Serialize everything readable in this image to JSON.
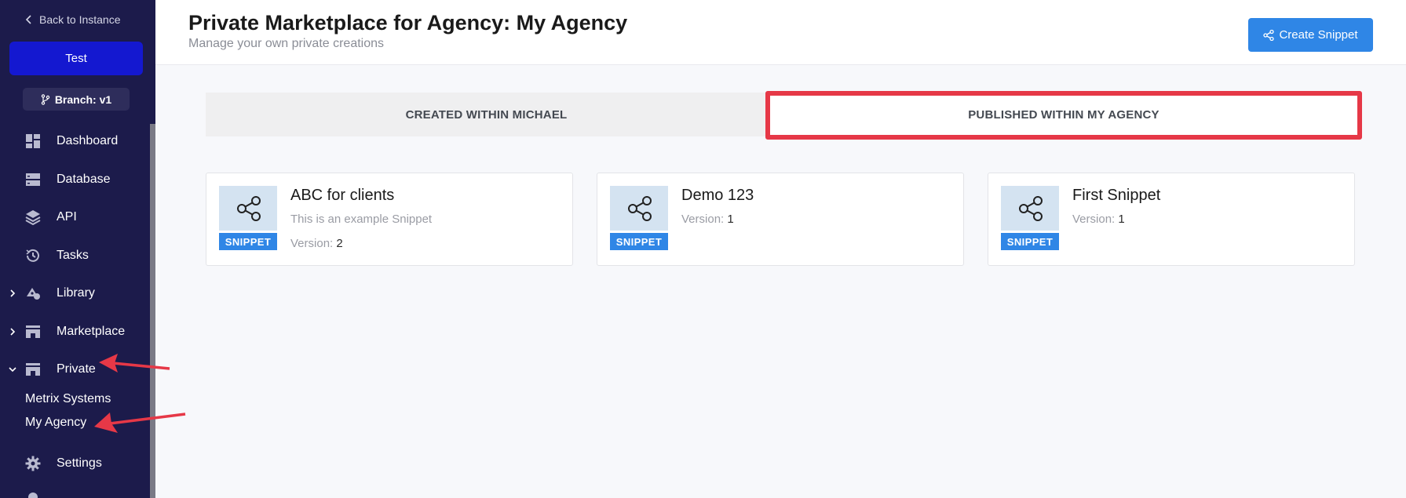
{
  "sidebar": {
    "back_label": "Back to Instance",
    "instance_label": "Test",
    "branch_label": "Branch: v1",
    "items": [
      {
        "label": "Dashboard",
        "icon": "dashboard-icon"
      },
      {
        "label": "Database",
        "icon": "database-icon"
      },
      {
        "label": "API",
        "icon": "api-icon"
      },
      {
        "label": "Tasks",
        "icon": "history-icon"
      },
      {
        "label": "Library",
        "icon": "library-icon"
      },
      {
        "label": "Marketplace",
        "icon": "store-icon"
      },
      {
        "label": "Private",
        "icon": "store-icon"
      },
      {
        "label": "Settings",
        "icon": "gear-icon"
      }
    ],
    "private_subitems": [
      "Metrix Systems",
      "My Agency"
    ]
  },
  "header": {
    "title": "Private Marketplace for Agency: My Agency",
    "subtitle": "Manage your own private creations",
    "create_label": "Create Snippet"
  },
  "tabs": [
    {
      "label": "CREATED WITHIN MICHAEL",
      "active": false
    },
    {
      "label": "PUBLISHED WITHIN MY AGENCY",
      "active": true
    }
  ],
  "cards": [
    {
      "title": "ABC for clients",
      "description": "This is an example Snippet",
      "version_label": "Version:",
      "version": "2",
      "badge": "SNIPPET"
    },
    {
      "title": "Demo 123",
      "version_label": "Version:",
      "version": "1",
      "badge": "SNIPPET"
    },
    {
      "title": "First Snippet",
      "version_label": "Version:",
      "version": "1",
      "badge": "SNIPPET"
    }
  ],
  "colors": {
    "sidebar_bg": "#1c1b4b",
    "primary": "#2f86e6",
    "instance_button": "#1418d0",
    "annotation_red": "#e63847"
  }
}
